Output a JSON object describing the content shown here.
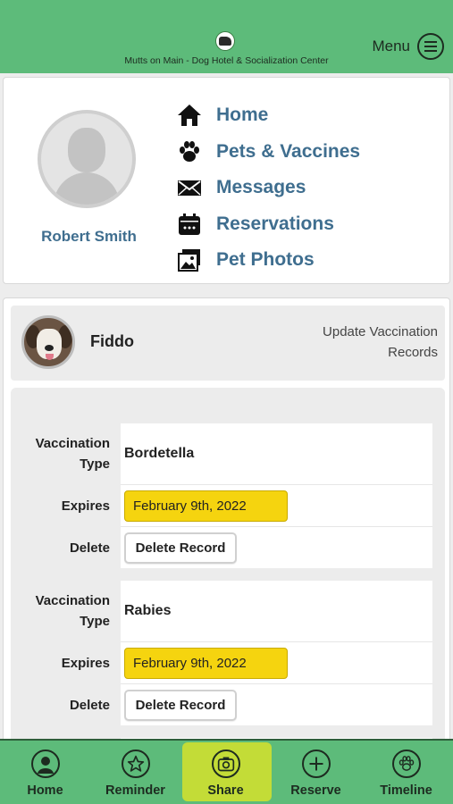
{
  "header": {
    "title": "Mutts on Main - Dog Hotel & Socialization Center",
    "menu_label": "Menu"
  },
  "profile": {
    "name": "Robert Smith"
  },
  "nav": {
    "items": [
      {
        "label": "Home",
        "icon": "home-icon"
      },
      {
        "label": "Pets & Vaccines",
        "icon": "paw-icon"
      },
      {
        "label": "Messages",
        "icon": "envelope-icon"
      },
      {
        "label": "Reservations",
        "icon": "calendar-icon"
      },
      {
        "label": "Pet Photos",
        "icon": "photos-icon"
      }
    ]
  },
  "pet": {
    "name": "Fiddo",
    "update_link": "Update Vaccination Records"
  },
  "records": {
    "type_label": "Vaccination Type",
    "expires_label": "Expires",
    "delete_label": "Delete",
    "delete_button": "Delete Record",
    "items": [
      {
        "type": "Bordetella",
        "expires": "February 9th, 2022"
      },
      {
        "type": "Rabies",
        "expires": "February 9th, 2022"
      }
    ]
  },
  "bottom_nav": {
    "tabs": [
      {
        "label": "Home",
        "icon": "person-icon"
      },
      {
        "label": "Reminder",
        "icon": "star-icon"
      },
      {
        "label": "Share",
        "icon": "camera-icon",
        "active": true
      },
      {
        "label": "Reserve",
        "icon": "plus-icon"
      },
      {
        "label": "Timeline",
        "icon": "paw-icon"
      }
    ]
  },
  "colors": {
    "brand_green": "#5dbb7a",
    "active_tab": "#c3dc37",
    "link_blue": "#3f6e8f",
    "date_yellow": "#f5d40f"
  }
}
